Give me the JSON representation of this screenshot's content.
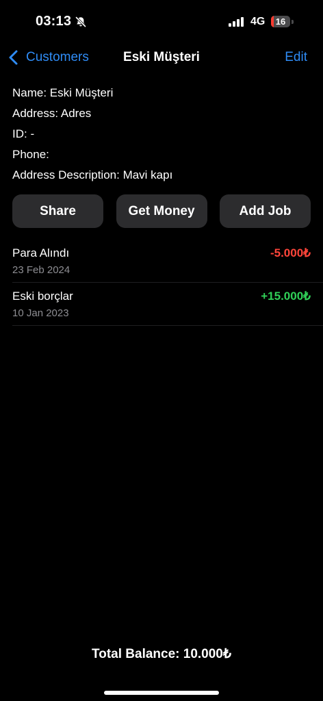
{
  "status_bar": {
    "time": "03:13",
    "network": "4G",
    "battery_level": "16",
    "battery_percent": 16,
    "battery_color": "#ff3b30",
    "icons": [
      "bell-slash-icon",
      "signal-bars-icon",
      "battery-icon"
    ]
  },
  "nav": {
    "back_label": "Customers",
    "back_icon": "chevron-left-icon",
    "title": "Eski Müşteri",
    "edit_label": "Edit",
    "accent_color": "#2f8cf6"
  },
  "customer": {
    "name_line": "Name: Eski Müşteri",
    "address_line": "Address: Adres",
    "id_line": "ID: -",
    "phone_line": "Phone:",
    "address_description_line": "Address Description: Mavi kapı"
  },
  "actions": {
    "share_label": "Share",
    "get_money_label": "Get Money",
    "add_job_label": "Add Job"
  },
  "transactions": [
    {
      "title": "Para Alındı",
      "date": "23 Feb 2024",
      "amount": "-5.000₺",
      "color": "#ff453a"
    },
    {
      "title": "Eski borçlar",
      "date": "10 Jan 2023",
      "amount": "+15.000₺",
      "color": "#30d158"
    }
  ],
  "total": {
    "label": "Total Balance: 10.000₺"
  }
}
